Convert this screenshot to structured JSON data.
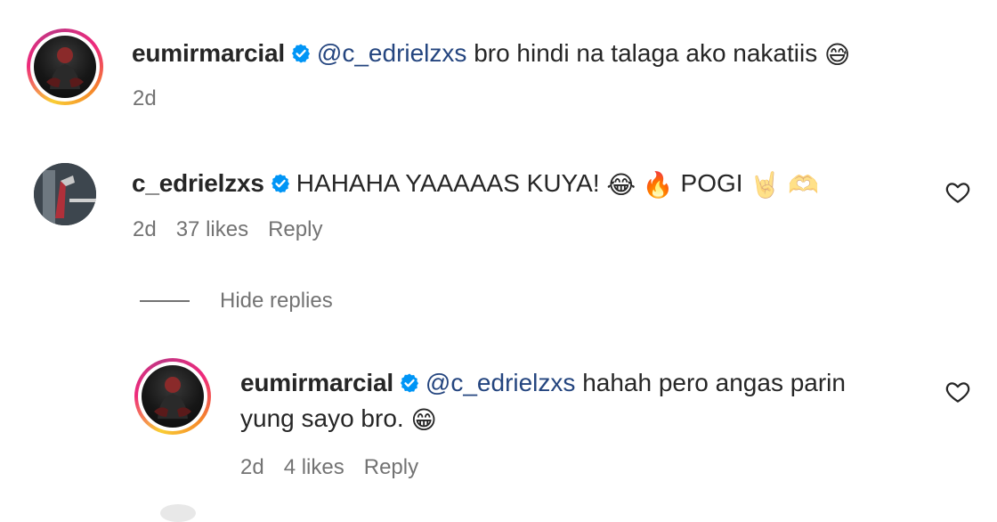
{
  "comments": [
    {
      "username": "eumirmarcial",
      "mention": "@c_edrielzxs",
      "text": "bro hindi na talaga ako nakatiis",
      "emoji": "😅",
      "time": "2d"
    },
    {
      "username": "c_edrielzxs",
      "text_part1": "HAHAHA YAAAAAS KUYA!",
      "emoji1": "😂",
      "emoji2": "🔥",
      "text_part2": "POGI",
      "emoji3": "🤘",
      "emoji4": "🫶",
      "time": "2d",
      "likes": "37 likes",
      "reply_label": "Reply"
    }
  ],
  "replies_toggle": "Hide replies",
  "reply": {
    "username": "eumirmarcial",
    "mention": "@c_edrielzxs",
    "text_line1": "hahah pero angas parin",
    "text_line2": "yung sayo bro.",
    "emoji": "😁",
    "time": "2d",
    "likes": "4 likes",
    "reply_label": "Reply"
  },
  "icons": {
    "verified": "verified-badge-icon",
    "like": "heart-outline-icon"
  },
  "colors": {
    "verified_blue": "#0095f6",
    "mention": "#24457f",
    "meta_gray": "#737373"
  }
}
